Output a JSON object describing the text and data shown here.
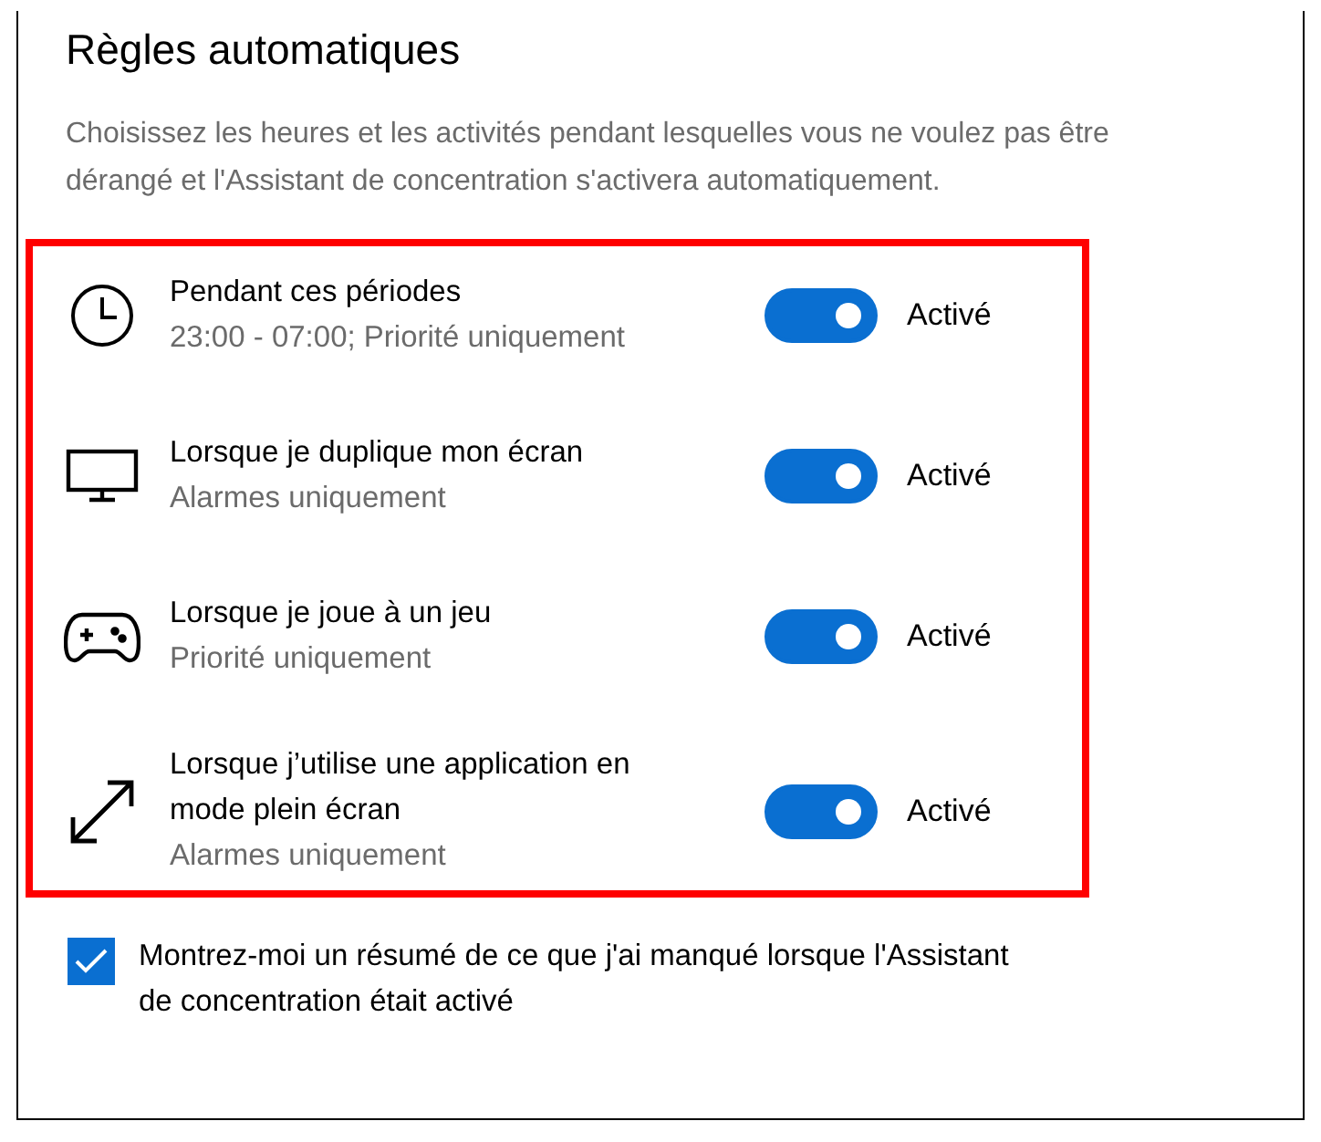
{
  "title": "Règles automatiques",
  "description": "Choisissez les heures et les activités pendant lesquelles vous ne voulez pas être dérangé et l'Assistant de concentration s'activera automatiquement.",
  "rules": [
    {
      "kind": "clock",
      "title": "Pendant ces périodes",
      "subtitle": "23:00 - 07:00; Priorité uniquement",
      "on": true,
      "state_label": "Activé"
    },
    {
      "kind": "monitor",
      "title": "Lorsque je duplique mon écran",
      "subtitle": "Alarmes uniquement",
      "on": true,
      "state_label": "Activé"
    },
    {
      "kind": "gamepad",
      "title": "Lorsque je joue à un jeu",
      "subtitle": "Priorité uniquement",
      "on": true,
      "state_label": "Activé"
    },
    {
      "kind": "expand",
      "title": "Lorsque j’utilise une application en mode plein écran",
      "subtitle": "Alarmes uniquement",
      "on": true,
      "state_label": "Activé"
    }
  ],
  "summary_checkbox": {
    "label": "Montrez-moi un résumé de ce que j'ai manqué lorsque l'Assistant de concentration était activé",
    "checked": true
  }
}
